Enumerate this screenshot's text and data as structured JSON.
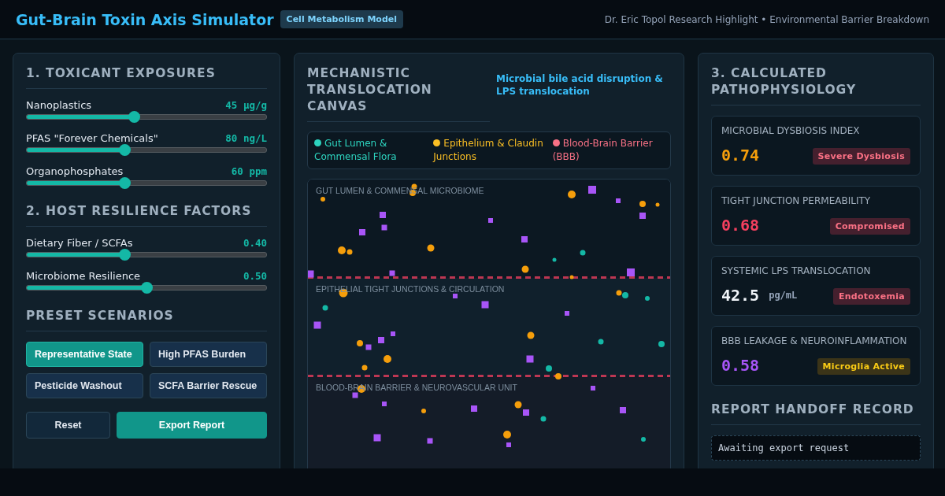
{
  "header": {
    "title": "Gut-Brain Toxin Axis Simulator",
    "badge": "Cell Metabolism Model",
    "tagline": "Dr. Eric Topol Research Highlight • Environmental Barrier Breakdown"
  },
  "controls": {
    "exposures_title": "1. TOXICANT EXPOSURES",
    "exposures": [
      {
        "label": "Nanoplastics",
        "reading": "45 µg/g",
        "level": 0.45
      },
      {
        "label": "PFAS \"Forever Chemicals\"",
        "reading": "80 ng/L",
        "level": 0.41
      },
      {
        "label": "Organophosphates",
        "reading": "60 ppm",
        "level": 0.41
      }
    ],
    "resilience_title": "2. HOST RESILIENCE FACTORS",
    "resilience": [
      {
        "label": "Dietary Fiber / SCFAs",
        "reading": "0.40",
        "level": 0.41
      },
      {
        "label": "Microbiome Resilience",
        "reading": "0.50",
        "level": 0.5
      }
    ],
    "presets_title": "PRESET SCENARIOS",
    "presets": [
      {
        "label": "Representative State",
        "selected": true
      },
      {
        "label": "High PFAS Burden",
        "selected": false
      },
      {
        "label": "Pesticide Washout",
        "selected": false
      },
      {
        "label": "SCFA Barrier Rescue",
        "selected": false
      }
    ],
    "actions": [
      {
        "label": "Reset",
        "kind": "secondary"
      },
      {
        "label": "Export Report",
        "kind": "primary"
      }
    ]
  },
  "canvas": {
    "title": "MECHANISTIC TRANSLOCATION CANVAS",
    "subtitle": "Microbial bile acid disruption & LPS translocation",
    "legend": [
      {
        "label": "Gut Lumen & Commensal Flora",
        "color": "#2dd4bf"
      },
      {
        "label": "Epithelium & Claudin Junctions",
        "color": "#fbbf24"
      },
      {
        "label": "Blood-Brain Barrier (BBB)",
        "color": "#f87185"
      }
    ],
    "zones": [
      "GUT LUMEN & COMMENSAL MICROBIOME",
      "EPITHELIAL TIGHT JUNCTIONS & CIRCULATION",
      "BLOOD-BRAIN BARRIER & NEUROVASCULAR UNIT"
    ]
  },
  "results": {
    "title": "3. CALCULATED PATHOPHYSIOLOGY",
    "metrics": [
      {
        "label": "MICROBIAL DYSBIOSIS INDEX",
        "value": "0.74",
        "color": "#f59e0b",
        "badge": "Severe Dysbiosis",
        "kind": "danger"
      },
      {
        "label": "TIGHT JUNCTION PERMEABILITY",
        "value": "0.68",
        "color": "#f43f5e",
        "badge": "Compromised",
        "kind": "danger"
      },
      {
        "label": "SYSTEMIC LPS TRANSLOCATION",
        "value": "42.5",
        "unit": "pg/mL",
        "color": "#f1f5f9",
        "badge": "Endotoxemia",
        "kind": "danger"
      },
      {
        "label": "BBB LEAKAGE & NEUROINFLAMMATION",
        "value": "0.58",
        "color": "#a855f7",
        "badge": "Microglia Active",
        "kind": "warning"
      }
    ],
    "report_title": "REPORT HANDOFF RECORD",
    "report_text": "Awaiting export request"
  }
}
